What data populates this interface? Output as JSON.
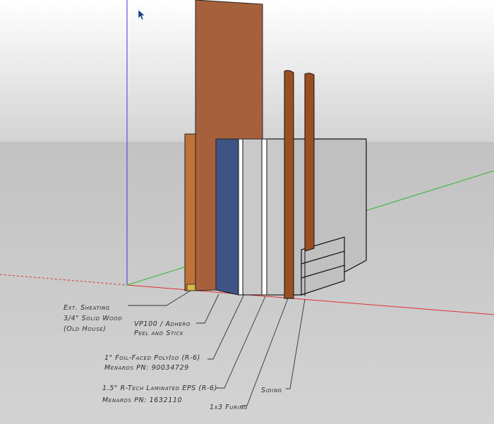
{
  "model": {
    "colors": {
      "sky_top": "#ffffff",
      "sky_bottom": "#d3d3d3",
      "ground_top": "#c2c2c2",
      "ground_bottom": "#d3d3d3",
      "sheathing": "#a6613c",
      "solid_wood": "#bf7338",
      "peel_and_stick": "#3d5485",
      "foam_board": "#c9c9c9",
      "furring": "#9a4f22",
      "siding": "#c0c0c0",
      "axis_red": "#e03030",
      "axis_green": "#2fb82f",
      "axis_blue": "#3a3adf"
    },
    "cursor_icon": "arrow-cursor-icon",
    "labels": [
      {
        "id": "sheathing",
        "lines": [
          "Ext. Sheating",
          "3/4\" Solid Wood",
          "(Old House)"
        ]
      },
      {
        "id": "vp100",
        "lines": [
          "VP100 / Adhero",
          "Peel and Stick"
        ]
      },
      {
        "id": "polyiso",
        "lines": [
          "1\" Foil-Faced PolyIso (R-6)",
          "Menards PN: 90034729"
        ]
      },
      {
        "id": "eps",
        "lines": [
          "1.5\" R-Tech Laminated EPS (R-6)",
          "Menards PN: 1632110"
        ]
      },
      {
        "id": "siding",
        "lines": [
          "Siding"
        ]
      },
      {
        "id": "furing",
        "lines": [
          "1x3 Furing"
        ]
      }
    ]
  }
}
